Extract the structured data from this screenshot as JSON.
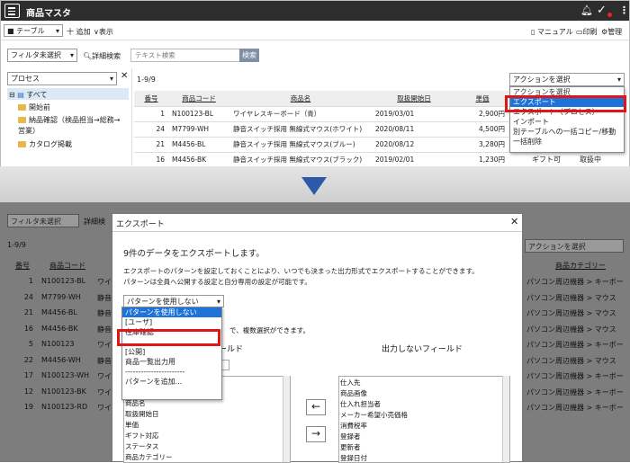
{
  "app": {
    "title": "商品マスタ"
  },
  "toolbar": {
    "table_select": "■ テーブル",
    "add": "十 追加",
    "show": "表示",
    "manual": "マニュアル",
    "print": "印刷",
    "admin": "管理"
  },
  "filter": {
    "select": "フィルタ未選択",
    "detail_search": "詳細検索",
    "text_placeholder": "テキスト検索",
    "search_btn": "検索"
  },
  "left": {
    "process_select": "プロセス",
    "close": "✕",
    "tree": [
      "すべて",
      "開始前",
      "納品確認（検品担当→総務→営業）",
      "カタログ掲載"
    ]
  },
  "table": {
    "count": "1-9/9",
    "headers": [
      "番号",
      "商品コード",
      "商品名",
      "取扱開始日",
      "単価"
    ],
    "rows": [
      {
        "no": "1",
        "code": "N100123-BL",
        "name": "ワイヤレスキーボード（青）",
        "date": "2019/03/01",
        "price": "2,900円"
      },
      {
        "no": "24",
        "code": "M7799-WH",
        "name": "静音スイッチ採用 無線式マウス(ホワイト)",
        "date": "2020/08/11",
        "price": "4,500円"
      },
      {
        "no": "21",
        "code": "M4456-BL",
        "name": "静音スイッチ採用 無線式マウス(ブルー)",
        "date": "2020/08/12",
        "price": "3,280円"
      },
      {
        "no": "16",
        "code": "M4456-BK",
        "name": "静音スイッチ採用 無線式マウス(ブラック)",
        "date": "2019/02/01",
        "price": "1,230円"
      }
    ],
    "extra": [
      "ギフト可",
      "取扱中"
    ]
  },
  "action": {
    "select": "アクションを選択",
    "menu": [
      "アクションを選択",
      "エクスポート",
      "エクスポート（プロセス）",
      "インポート",
      "別テーブルへの一括コピー/移動",
      "一括削除"
    ]
  },
  "bottom_bg": {
    "filter": "フィルタ未選択",
    "detail": "詳細検",
    "count": "1-9/9",
    "h_no": "番号",
    "h_code": "商品コード",
    "h_cat": "商品カテゴリー",
    "action": "アクションを選択",
    "rows": [
      {
        "no": "1",
        "code": "N100123-BL",
        "pre": "ワイ"
      },
      {
        "no": "24",
        "code": "M7799-WH",
        "pre": "静音"
      },
      {
        "no": "21",
        "code": "M4456-BL",
        "pre": "静音"
      },
      {
        "no": "16",
        "code": "M4456-BK",
        "pre": "静音"
      },
      {
        "no": "5",
        "code": "N100123",
        "pre": "ワイ"
      },
      {
        "no": "22",
        "code": "M4456-WH",
        "pre": "静音"
      },
      {
        "no": "17",
        "code": "N100123-WH",
        "pre": "ワイ"
      },
      {
        "no": "12",
        "code": "N100123-BK",
        "pre": "ワイ"
      },
      {
        "no": "19",
        "code": "N100123-RD",
        "pre": "ワイ"
      }
    ],
    "cat": "パソコン周辺機器 > キーボー",
    "cat2": "パソコン周辺機器 > マウス"
  },
  "dialog": {
    "title": "エクスポート",
    "close": "✕",
    "heading": "9件のデータをエクスポートします。",
    "desc1": "エクスポートのパターンを設定しておくことにより、いつでも決まった出力形式でエクスポートすることができます。",
    "desc2": "パターンは全員へ公開する設定と自分専用の設定が可能です。",
    "pattern_select": "パターンを使用しない",
    "pattern_menu": [
      "パターンを使用しない",
      "[ユーザ]",
      "在庫確認",
      "",
      "[公開]",
      "商品一覧出力用",
      "-----------------------",
      "パターンを追加..."
    ],
    "multi_hint": "で、複数選択ができます。",
    "out_label": "ールド",
    "no_out_label": "出力しないフィールド",
    "left_list": [
      "商品名",
      "取扱開始日",
      "単価",
      "ギフト対応",
      "ステータス",
      "商品カテゴリー"
    ],
    "right_list": [
      "仕入先",
      "商品画像",
      "仕入れ担当者",
      "メーカー希望小売価格",
      "消費税率",
      "登録者",
      "更新者",
      "登録日付"
    ],
    "left_btn": "←",
    "right_btn": "→"
  }
}
